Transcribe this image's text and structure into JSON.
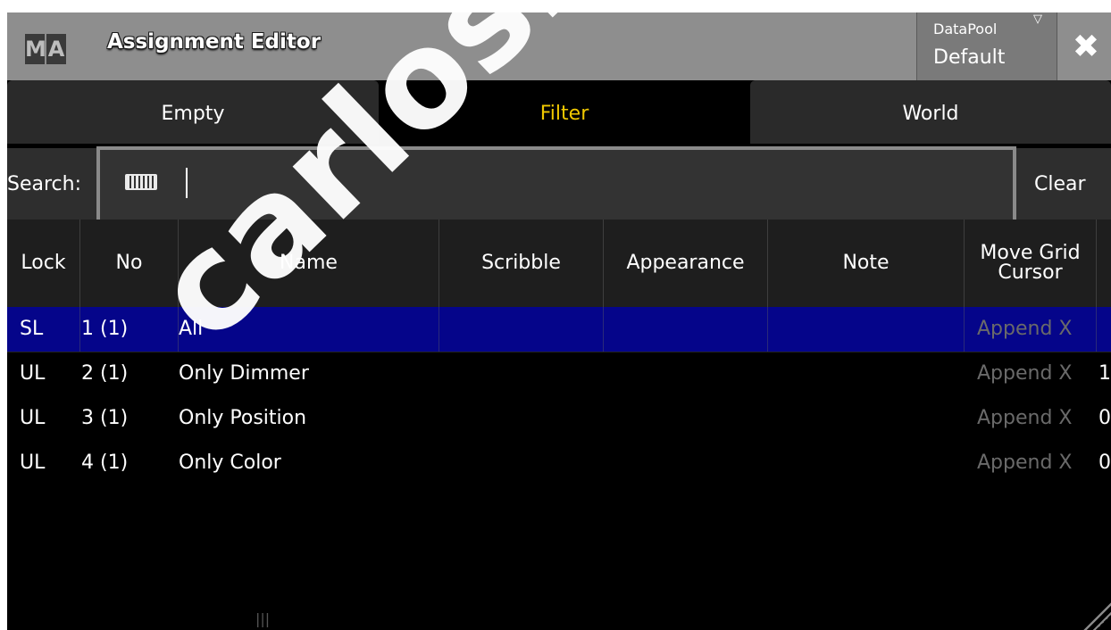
{
  "titlebar": {
    "logo_letters": [
      "M",
      "A"
    ],
    "title": "Assignment Editor",
    "datapool_label": "DataPool",
    "datapool_value": "Default",
    "datapool_arrow": "▽",
    "close_glyph": "✖"
  },
  "tabs": [
    {
      "label": "Empty",
      "active": false
    },
    {
      "label": "Filter",
      "active": true
    },
    {
      "label": "World",
      "active": false
    }
  ],
  "search": {
    "label": "Search:",
    "clear_label": "Clear",
    "value": ""
  },
  "table": {
    "columns": [
      "Lock",
      "No",
      "Name",
      "Scribble",
      "Appearance",
      "Note",
      "Move Grid Cursor"
    ],
    "rows": [
      {
        "lock": "SL",
        "no": "1 (1)",
        "name": "All",
        "move": "Append X",
        "extra": "",
        "selected": true
      },
      {
        "lock": "UL",
        "no": "2 (1)",
        "name": "Only Dimmer",
        "move": "Append X",
        "extra": "1",
        "selected": false
      },
      {
        "lock": "UL",
        "no": "3 (1)",
        "name": "Only Position",
        "move": "Append X",
        "extra": "0",
        "selected": false
      },
      {
        "lock": "UL",
        "no": "4 (1)",
        "name": "Only Color",
        "move": "Append X",
        "extra": "0",
        "selected": false
      }
    ]
  },
  "watermark": "carlosmendoza.",
  "colors": {
    "accent_active_tab": "#f0c800",
    "selected_row": "#05058a",
    "titlebar": "#8e8e8e"
  }
}
